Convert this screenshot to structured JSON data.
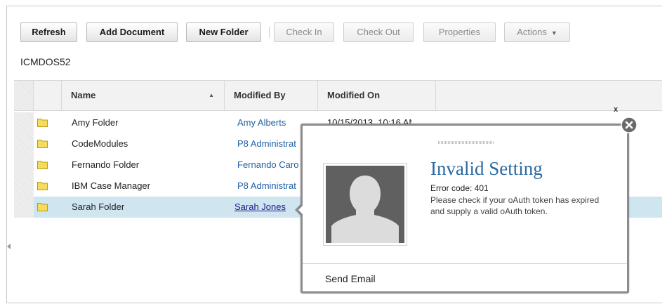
{
  "toolbar": {
    "refresh": "Refresh",
    "add_document": "Add Document",
    "new_folder": "New Folder",
    "check_in": "Check In",
    "check_out": "Check Out",
    "properties": "Properties",
    "actions": "Actions"
  },
  "repository": "ICMDOS52",
  "grid": {
    "columns": [
      "Name",
      "Modified By",
      "Modified On"
    ],
    "sort_column": "Name",
    "rows": [
      {
        "name": "Amy Folder",
        "modified_by": "Amy Alberts",
        "modified_on": "10/15/2013, 10:16 AM"
      },
      {
        "name": "CodeModules",
        "modified_by": "P8 Administrat",
        "modified_on": ""
      },
      {
        "name": "Fernando Folder",
        "modified_by": "Fernando Caro",
        "modified_on": ""
      },
      {
        "name": "IBM Case Manager",
        "modified_by": "P8 Administrat",
        "modified_on": ""
      },
      {
        "name": "Sarah Folder",
        "modified_by": "Sarah Jones",
        "modified_on": ""
      }
    ],
    "selected_row": 4
  },
  "popup": {
    "title": "Invalid Setting",
    "error_code": "Error code: 401",
    "message": "Please check if your oAuth token has expired and supply a valid oAuth token.",
    "send_email": "Send Email",
    "close_label": "x"
  },
  "colors": {
    "link": "#1f5fa6",
    "title": "#2a6aa0",
    "selected_row": "#cfe6f0",
    "folder": "#f5d94a"
  },
  "icons": [
    "folder-icon",
    "close-icon",
    "sort-ascending-icon",
    "dropdown-caret-icon",
    "avatar-placeholder-icon"
  ]
}
